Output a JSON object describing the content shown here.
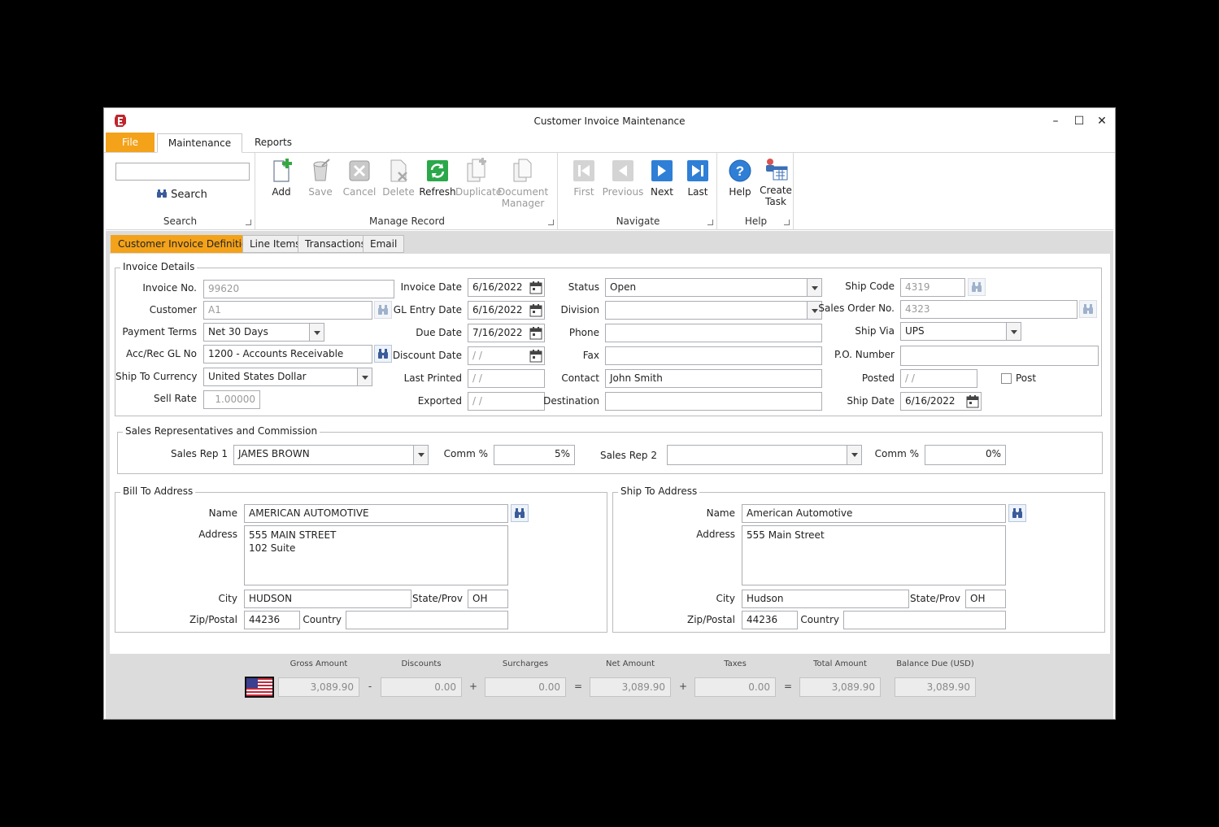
{
  "window": {
    "title": "Customer Invoice Maintenance",
    "controls": {
      "minimize": "–",
      "maximize": "☐",
      "close": "✕"
    }
  },
  "ribbon_tabs": {
    "file": "File",
    "maintenance": "Maintenance",
    "reports": "Reports"
  },
  "ribbon": {
    "search": {
      "input_value": "",
      "button": "Search",
      "group": "Search"
    },
    "manage_record": {
      "group": "Manage Record",
      "add": "Add",
      "save": "Save",
      "cancel": "Cancel",
      "delete": "Delete",
      "refresh": "Refresh",
      "duplicate": "Duplicate",
      "document_manager_1": "Document",
      "document_manager_2": "Manager"
    },
    "navigate": {
      "group": "Navigate",
      "first": "First",
      "previous": "Previous",
      "next": "Next",
      "last": "Last"
    },
    "help": {
      "group": "Help",
      "help": "Help",
      "create_task_1": "Create",
      "create_task_2": "Task"
    }
  },
  "content_tabs": {
    "definition": "Customer Invoice Definition",
    "line_items": "Line Items",
    "transactions": "Transactions",
    "email": "Email"
  },
  "invoice_details": {
    "legend": "Invoice Details",
    "invoice_no": {
      "label": "Invoice No.",
      "value": "99620"
    },
    "customer": {
      "label": "Customer",
      "value": "A1"
    },
    "payment_terms": {
      "label": "Payment Terms",
      "value": "Net 30 Days"
    },
    "acc_rec_gl": {
      "label": "Acc/Rec GL No",
      "value": "1200 - Accounts Receivable"
    },
    "ship_to_currency": {
      "label": "Ship To Currency",
      "value": "United States Dollar"
    },
    "sell_rate": {
      "label": "Sell Rate",
      "value": "1.00000"
    },
    "invoice_date": {
      "label": "Invoice Date",
      "value": "6/16/2022"
    },
    "gl_entry_date": {
      "label": "GL Entry Date",
      "value": "6/16/2022"
    },
    "due_date": {
      "label": "Due Date",
      "value": "7/16/2022"
    },
    "discount_date": {
      "label": "Discount Date",
      "value": "/ /"
    },
    "last_printed": {
      "label": "Last Printed",
      "value": "/ /"
    },
    "exported": {
      "label": "Exported",
      "value": "/ /"
    },
    "status": {
      "label": "Status",
      "value": "Open"
    },
    "division": {
      "label": "Division",
      "value": ""
    },
    "phone": {
      "label": "Phone",
      "value": ""
    },
    "fax": {
      "label": "Fax",
      "value": ""
    },
    "contact": {
      "label": "Contact",
      "value": "John Smith"
    },
    "destination": {
      "label": "Destination",
      "value": ""
    },
    "ship_code": {
      "label": "Ship Code",
      "value": "4319"
    },
    "sales_order_no": {
      "label": "Sales Order No.",
      "value": "4323"
    },
    "ship_via": {
      "label": "Ship Via",
      "value": "UPS"
    },
    "po_number": {
      "label": "P.O. Number",
      "value": ""
    },
    "posted": {
      "label": "Posted",
      "value": "/ /"
    },
    "post_checkbox": {
      "label": "Post",
      "checked": false
    },
    "ship_date": {
      "label": "Ship Date",
      "value": "6/16/2022"
    }
  },
  "sales_reps": {
    "legend": "Sales Representatives and Commission",
    "rep1": {
      "label": "Sales Rep 1",
      "value": "JAMES BROWN"
    },
    "comm1": {
      "label": "Comm %",
      "value": "5%"
    },
    "rep2": {
      "label": "Sales Rep 2",
      "value": ""
    },
    "comm2": {
      "label": "Comm %",
      "value": "0%"
    }
  },
  "bill_to": {
    "legend": "Bill To Address",
    "name": {
      "label": "Name",
      "value": "AMERICAN AUTOMOTIVE"
    },
    "address": {
      "label": "Address",
      "value": "555 MAIN STREET\n102 Suite"
    },
    "city": {
      "label": "City",
      "value": "HUDSON"
    },
    "state": {
      "label": "State/Prov",
      "value": "OH"
    },
    "zip": {
      "label": "Zip/Postal",
      "value": "44236"
    },
    "country": {
      "label": "Country",
      "value": ""
    }
  },
  "ship_to": {
    "legend": "Ship To Address",
    "name": {
      "label": "Name",
      "value": "American Automotive"
    },
    "address": {
      "label": "Address",
      "value": "555 Main Street"
    },
    "city": {
      "label": "City",
      "value": "Hudson"
    },
    "state": {
      "label": "State/Prov",
      "value": "OH"
    },
    "zip": {
      "label": "Zip/Postal",
      "value": "44236"
    },
    "country": {
      "label": "Country",
      "value": ""
    }
  },
  "totals": {
    "gross": {
      "label": "Gross Amount",
      "value": "3,089.90"
    },
    "discounts": {
      "label": "Discounts",
      "value": "0.00"
    },
    "surcharges": {
      "label": "Surcharges",
      "value": "0.00"
    },
    "net": {
      "label": "Net Amount",
      "value": "3,089.90"
    },
    "taxes": {
      "label": "Taxes",
      "value": "0.00"
    },
    "total": {
      "label": "Total Amount",
      "value": "3,089.90"
    },
    "balance": {
      "label": "Balance Due (USD)",
      "value": "3,089.90"
    },
    "ops": {
      "minus": "-",
      "plus1": "+",
      "eq1": "=",
      "plus2": "+",
      "eq2": "="
    }
  },
  "colors": {
    "accent": "#f3a21a",
    "nav_blue": "#2f7fd6",
    "refresh_green": "#2aa84a",
    "logo_red": "#c0262c"
  }
}
